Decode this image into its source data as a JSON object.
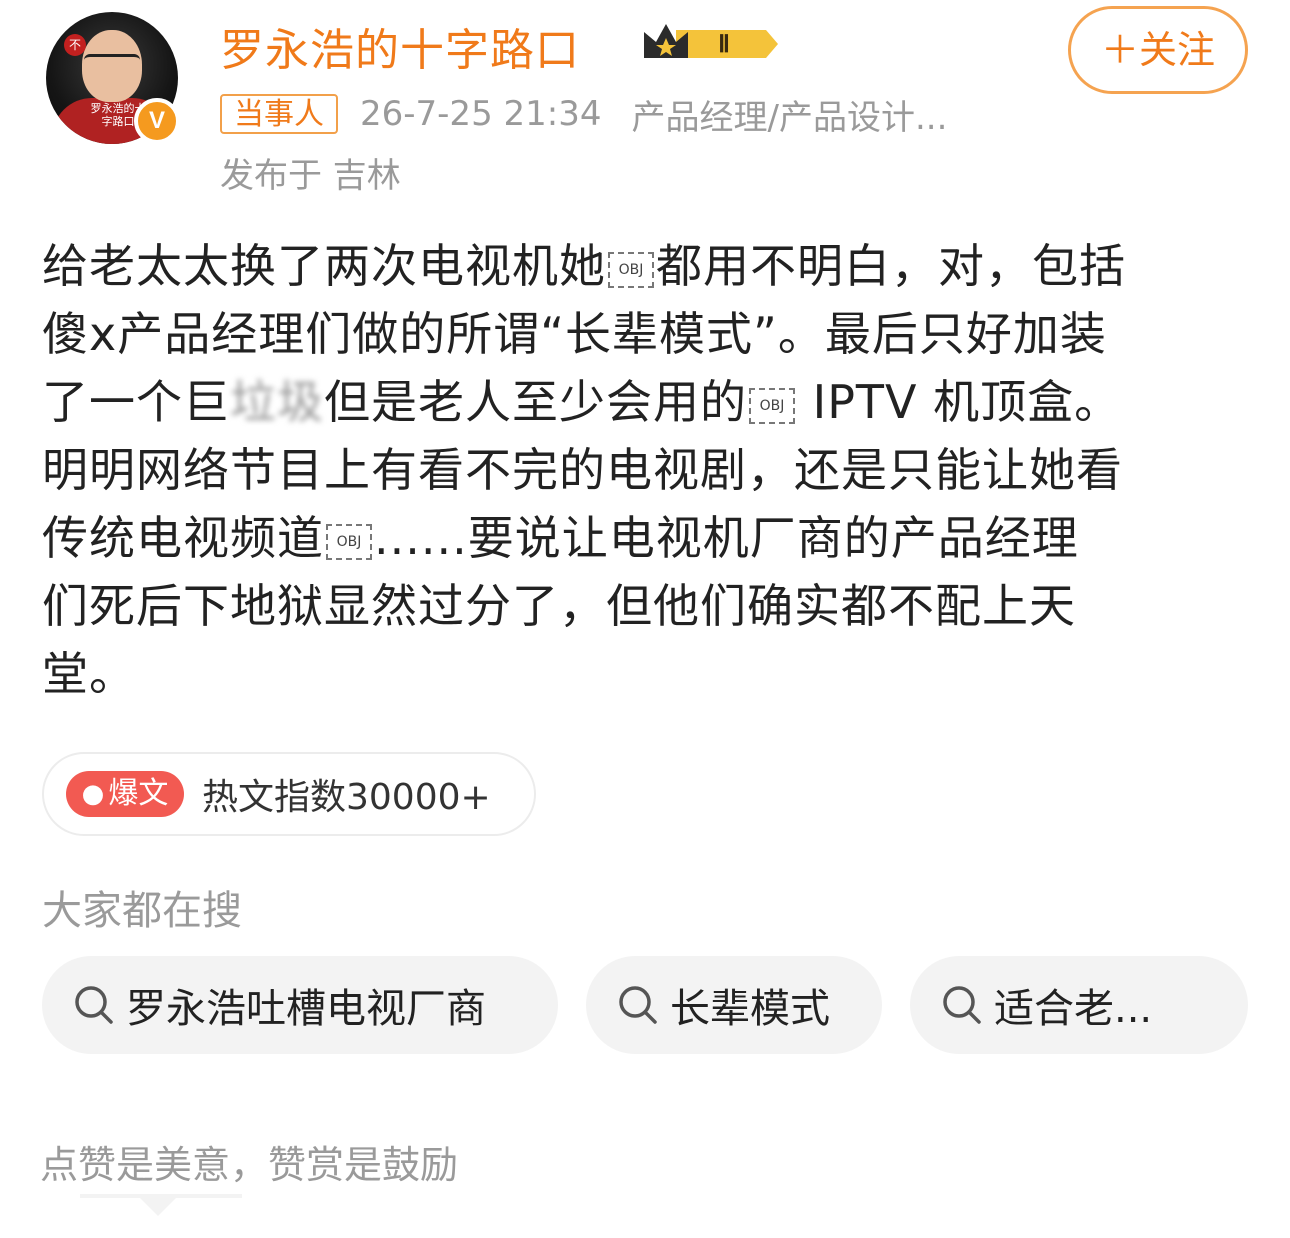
{
  "header": {
    "username": "罗永浩的十字路口",
    "level_badge": "Ⅱ",
    "follow_label": "＋关注",
    "avatar_caption": "罗永浩的十字路口",
    "verified_mark": "V",
    "party_badge": "当事人",
    "date": "26-7-25 21:34",
    "source": "产品经理/产品设计...",
    "location": "发布于 吉林"
  },
  "post": {
    "obj_label": "OBJ",
    "line1_a": "给老太太换了两次电视机她",
    "line1_b": "都用不明白，对，包括",
    "line2": "傻x产品经理们做的所谓“长辈模式”。最后只好加装",
    "line3_a": "了一个巨",
    "line3_blur": "垃圾",
    "line3_b": "但是老人至少会用的",
    "line3_c": " IPTV 机顶盒。",
    "line4": "明明网络节目上有看不完的电视剧，还是只能让她看",
    "line5_a": "传统电视频道",
    "line5_b": "......要说让电视机厂商的产品经理",
    "line6": "们死后下地狱显然过分了，但他们确实都不配上天",
    "line7": "堂。"
  },
  "hot": {
    "badge_label": "爆文",
    "index_text": "热文指数30000+"
  },
  "search": {
    "title": "大家都在搜",
    "chips": [
      "罗永浩吐槽电视厂商",
      "长辈模式",
      "适合老..."
    ]
  },
  "footer": {
    "text": "点赞是美意，赞赏是鼓励"
  },
  "colors": {
    "accent": "#f07a1a",
    "hot_badge": "#f25a52",
    "muted": "#9a9a9a"
  }
}
